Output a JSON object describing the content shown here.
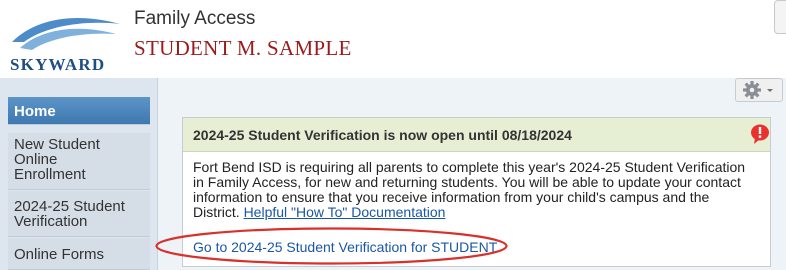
{
  "header": {
    "logo_text": "SKYWARD",
    "app_title": "Family Access",
    "student_name": "STUDENT M. SAMPLE"
  },
  "sidebar": {
    "items": [
      {
        "label": "Home",
        "active": true
      },
      {
        "label_lines": [
          "New Student",
          "Online",
          "Enrollment"
        ],
        "active": false
      },
      {
        "label_lines": [
          "2024-25 Student",
          "Verification"
        ],
        "active": false
      },
      {
        "label": "Online Forms",
        "active": false
      }
    ]
  },
  "toolbar": {
    "settings_icon": "gear-icon"
  },
  "notice": {
    "title": "2024-25 Student Verification is now open until 08/18/2024",
    "alert_icon": "alert-balloon-icon",
    "alert_color": "#e8322e",
    "message_lines": [
      "Fort Bend ISD is requiring all parents to complete this year's 2024-25 Student Verification",
      "in Family Access, for new and returning students. You will be able to update your contact",
      "information to ensure that you receive information from your child's campus and the"
    ],
    "message_last_prefix": "District. ",
    "help_link": "Helpful \"How To\" Documentation",
    "action_link": "Go to 2024-25 Student Verification for STUDENT"
  },
  "colors": {
    "brand_blue": "#3d78b0",
    "student_name": "#9b1b1b",
    "link": "#1a57a6",
    "highlight_oval": "#d8302a"
  }
}
